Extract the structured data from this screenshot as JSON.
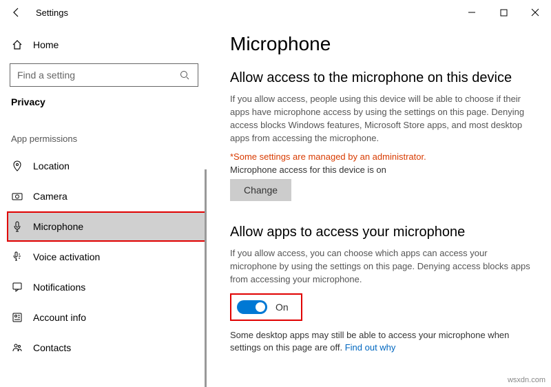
{
  "window": {
    "title": "Settings"
  },
  "sidebar": {
    "home": "Home",
    "search_placeholder": "Find a setting",
    "category": "Privacy",
    "section": "App permissions",
    "items": [
      {
        "label": "Location"
      },
      {
        "label": "Camera"
      },
      {
        "label": "Microphone"
      },
      {
        "label": "Voice activation"
      },
      {
        "label": "Notifications"
      },
      {
        "label": "Account info"
      },
      {
        "label": "Contacts"
      }
    ]
  },
  "main": {
    "title": "Microphone",
    "section1": {
      "heading": "Allow access to the microphone on this device",
      "desc": "If you allow access, people using this device will be able to choose if their apps have microphone access by using the settings on this page. Denying access blocks Windows features, Microsoft Store apps, and most desktop apps from accessing the microphone.",
      "admin_warning": "*Some settings are managed by an administrator.",
      "status": "Microphone access for this device is on",
      "change_label": "Change"
    },
    "section2": {
      "heading": "Allow apps to access your microphone",
      "desc": "If you allow access, you can choose which apps can access your microphone by using the settings on this page. Denying access blocks apps from accessing your microphone.",
      "toggle_label": "On",
      "footnote": "Some desktop apps may still be able to access your microphone when settings on this page are off. ",
      "link": "Find out why"
    }
  },
  "watermark": "wsxdn.com"
}
